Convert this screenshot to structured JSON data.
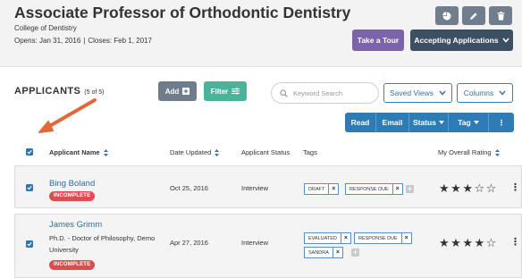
{
  "header": {
    "title": "Associate Professor of Orthodontic Dentistry",
    "college": "College of Dentistry",
    "opens": "Opens: Jan 31, 2016",
    "separator": "|",
    "closes": "Closes: Feb 1, 2017",
    "icons": [
      "pie-chart-icon",
      "pencil-icon",
      "trash-icon"
    ],
    "tour_label": "Take a Tour",
    "accepting_label": "Accepting Applications",
    "tour_color": "#7b64a8",
    "accepting_color": "#3c4f63"
  },
  "applicants": {
    "heading": "APPLICANTS",
    "count": "(5 of 5)",
    "add_label": "Add",
    "filter_label": "Filter",
    "search_placeholder": "Keyword Search",
    "saved_views_label": "Saved Views",
    "columns_label": "Columns",
    "toolbar": {
      "read": "Read",
      "email": "Email",
      "status": "Status",
      "tag": "Tag",
      "more": "⋮"
    },
    "toolbar_color": "#2e7cb6"
  },
  "table": {
    "columns": [
      "Applicant Name",
      "Date Updated",
      "Applicant Status",
      "Tags",
      "My Overall Rating"
    ],
    "rows": [
      {
        "name": "Bing Boland",
        "detail": "",
        "badge": "INCOMPLETE",
        "date": "Oct 25, 2016",
        "status": "Interview",
        "tags": [
          "DRAFT",
          "RESPONSE DUE"
        ],
        "rating": 3,
        "checked": true
      },
      {
        "name": "James Grimm",
        "detail": "Ph.D. - Doctor of Philosophy, Demo University",
        "badge": "INCOMPLETE",
        "date": "Apr 27, 2016",
        "status": "Interview",
        "tags": [
          "EVALUATED",
          "RESPONSE DUE",
          "SANDRA"
        ],
        "rating": 4,
        "checked": true
      }
    ]
  },
  "annotation": {
    "arrow_color": "#e0683a"
  },
  "badge_color": "#de4d4d"
}
